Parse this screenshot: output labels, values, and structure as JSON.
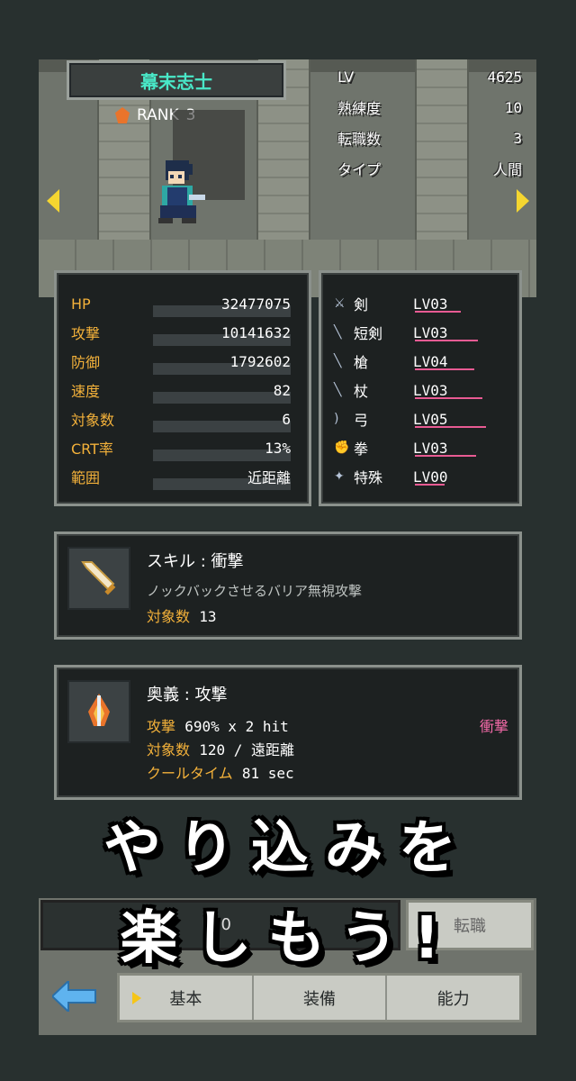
{
  "character": {
    "name": "幕末志士",
    "rank_label": "RANK",
    "rank_value": "3"
  },
  "info": [
    {
      "label": "LV",
      "value": "4625"
    },
    {
      "label": "熟練度",
      "value": "10"
    },
    {
      "label": "転職数",
      "value": "3"
    },
    {
      "label": "タイプ",
      "value": "人間"
    }
  ],
  "stats": [
    {
      "label": "HP",
      "value": "32477075"
    },
    {
      "label": "攻撃",
      "value": "10141632"
    },
    {
      "label": "防御",
      "value": "1792602"
    },
    {
      "label": "速度",
      "value": "82"
    },
    {
      "label": "対象数",
      "value": "6"
    },
    {
      "label": "CRT率",
      "value": "13%"
    },
    {
      "label": "範囲",
      "value": "近距離"
    }
  ],
  "weapons": [
    {
      "name": "剣",
      "level": "LV03",
      "icon": "sword-icon",
      "progress": 0.46
    },
    {
      "name": "短剣",
      "level": "LV03",
      "icon": "dagger-icon",
      "progress": 0.64
    },
    {
      "name": "槍",
      "level": "LV04",
      "icon": "spear-icon",
      "progress": 0.6
    },
    {
      "name": "杖",
      "level": "LV03",
      "icon": "staff-icon",
      "progress": 0.68
    },
    {
      "name": "弓",
      "level": "LV05",
      "icon": "bow-icon",
      "progress": 0.72
    },
    {
      "name": "拳",
      "level": "LV03",
      "icon": "fist-icon",
      "progress": 0.62
    },
    {
      "name": "特殊",
      "level": "LV00",
      "icon": "special-icon",
      "progress": 0.3
    }
  ],
  "skill": {
    "title": "スキル : 衝撃",
    "description": "ノックバックさせるバリア無視攻撃",
    "targets_label": "対象数",
    "targets_value": "13"
  },
  "ougi": {
    "title": "奥義 : 攻撃",
    "attack_label": "攻撃",
    "attack_value": "690% x 2 hit",
    "tag": "衝撃",
    "targets_label": "対象数",
    "targets_value": "120 / 遠距離",
    "cooldown_label": "クールタイム",
    "cooldown_value": "81 sec"
  },
  "slogan": {
    "line1": "やり込みを",
    "line2": "楽しもう!"
  },
  "bottom": {
    "partial_value": "70",
    "partial_right": "転職"
  },
  "tabs": [
    {
      "label": "基本",
      "selected": true
    },
    {
      "label": "装備",
      "selected": false
    },
    {
      "label": "能力",
      "selected": false
    }
  ],
  "colors": {
    "accent_name": "#49e8c8",
    "label_yellow": "#f3b13a",
    "pink": "#f36aa8"
  }
}
